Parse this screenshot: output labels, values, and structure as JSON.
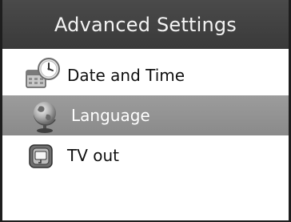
{
  "header": {
    "title": "Advanced Settings"
  },
  "menu": {
    "selected_index": 1,
    "items": [
      {
        "label": "Date and Time",
        "icon": "calendar-clock-icon"
      },
      {
        "label": "Language",
        "icon": "globe-icon"
      },
      {
        "label": "TV out",
        "icon": "tv-out-icon"
      }
    ]
  }
}
